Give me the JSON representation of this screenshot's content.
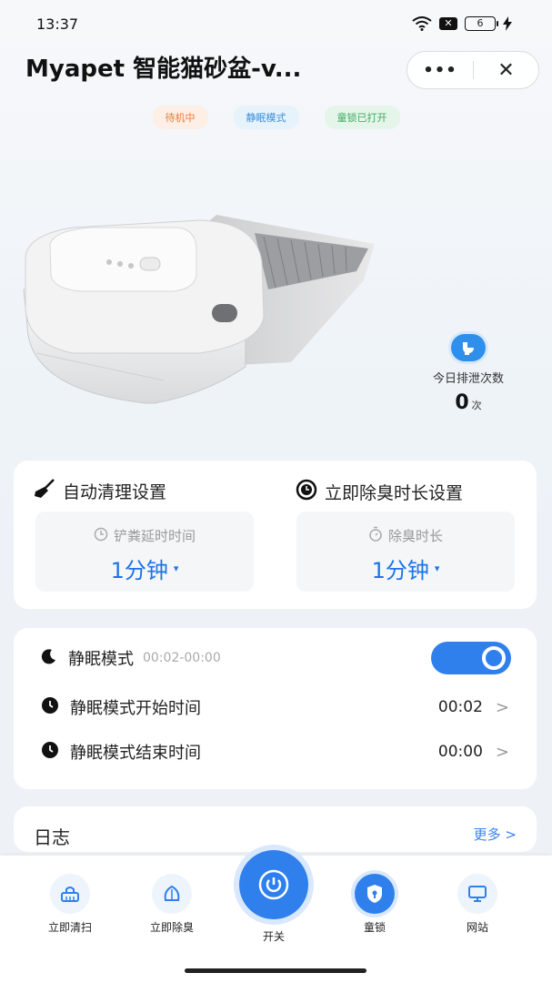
{
  "status": {
    "time": "13:37",
    "battery": "6"
  },
  "header": {
    "title": "Myapet 智能猫砂盆-v...",
    "more": "•••",
    "close": "✕"
  },
  "badges": {
    "standby": "待机中",
    "sleep_mode": "静眠模式",
    "child_lock": "童锁已打开"
  },
  "today": {
    "label": "今日排泄次数",
    "count": "0",
    "unit": "次"
  },
  "auto_clean": {
    "title": "自动清理设置",
    "box_label": "铲粪延时时间",
    "box_value": "1分钟",
    "caret": "▾"
  },
  "deodorize": {
    "title": "立即除臭时长设置",
    "box_label": "除臭时长",
    "box_value": "1分钟",
    "caret": "▾"
  },
  "sleep": {
    "label": "静眠模式",
    "range": "00:02-00:00",
    "enabled": true,
    "start_label": "静眠模式开始时间",
    "start_value": "00:02",
    "end_label": "静眠模式结束时间",
    "end_value": "00:00",
    "arrow": ">"
  },
  "log": {
    "title": "日志",
    "more": "更多 >"
  },
  "tabbar": {
    "clean": "立即清扫",
    "deodorize": "立即除臭",
    "power": "开关",
    "lock": "童锁",
    "site": "网站"
  },
  "colors": {
    "accent": "#2f80ed",
    "standby": "#f07a3a",
    "sleep": "#3b8ed8",
    "lock": "#3daa5e"
  }
}
